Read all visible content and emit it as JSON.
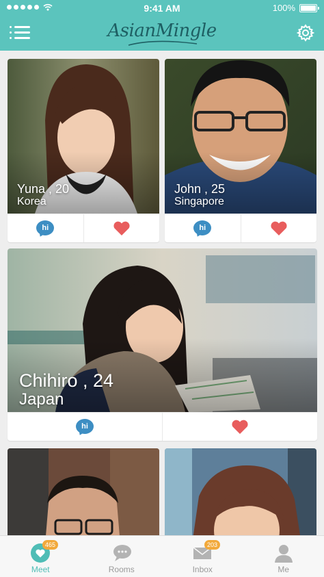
{
  "status_bar": {
    "time": "9:41 AM",
    "battery": "100%"
  },
  "nav": {
    "logo": "AsianMingle"
  },
  "profiles": [
    {
      "name": "Yuna , 20",
      "place": "Korea",
      "hi_label": "hi"
    },
    {
      "name": "John , 25",
      "place": "Singapore",
      "hi_label": "hi"
    },
    {
      "name": "Chihiro , 24",
      "place": "Japan",
      "hi_label": "hi"
    }
  ],
  "tabs": [
    {
      "label": "Meet",
      "badge": "465"
    },
    {
      "label": "Rooms"
    },
    {
      "label": "Inbox",
      "badge": "203"
    },
    {
      "label": "Me"
    }
  ],
  "colors": {
    "brand": "#5bc4bd",
    "hi": "#3d8ec3",
    "heart": "#e85d5d",
    "badge": "#f2a93b"
  }
}
